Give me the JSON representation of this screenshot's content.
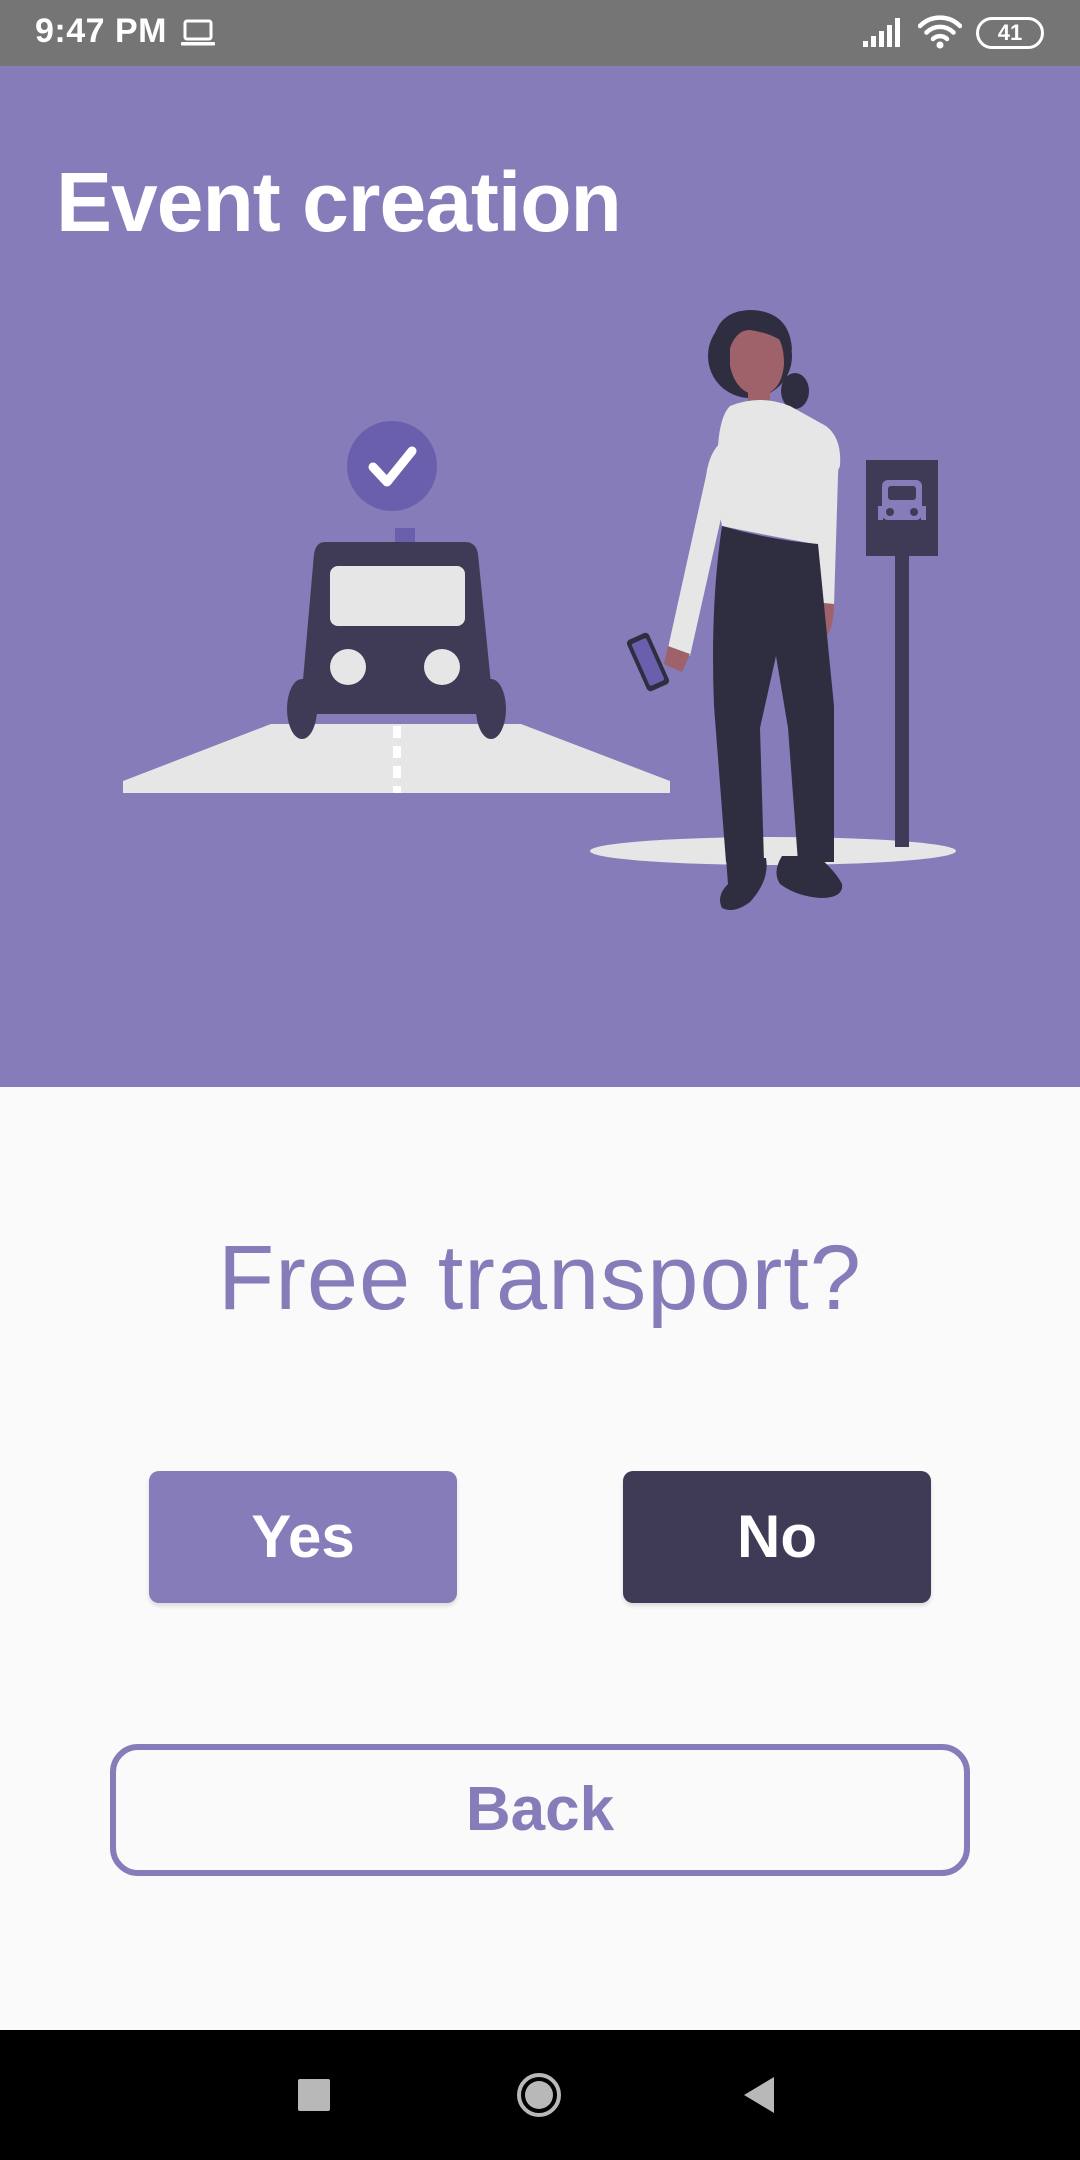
{
  "status_bar": {
    "time": "9:47 PM",
    "battery": "41",
    "icons": [
      "laptop-icon",
      "signal-icon",
      "wifi-icon",
      "battery-icon"
    ]
  },
  "header": {
    "title": "Event creation"
  },
  "illustration": {
    "icons": [
      "check-icon",
      "car-icon",
      "bus-stop-sign-icon",
      "phone-icon"
    ]
  },
  "question": {
    "text": "Free transport?"
  },
  "buttons": {
    "yes_label": "Yes",
    "no_label": "No",
    "back_label": "Back"
  },
  "nav_bar": {
    "icons": [
      "recents-icon",
      "home-icon",
      "back-icon"
    ]
  },
  "colors": {
    "accent": "#857cb9",
    "dark": "#3f3b56",
    "background": "#fafafa",
    "status_bar": "#757575",
    "nav_bar": "#000000"
  }
}
